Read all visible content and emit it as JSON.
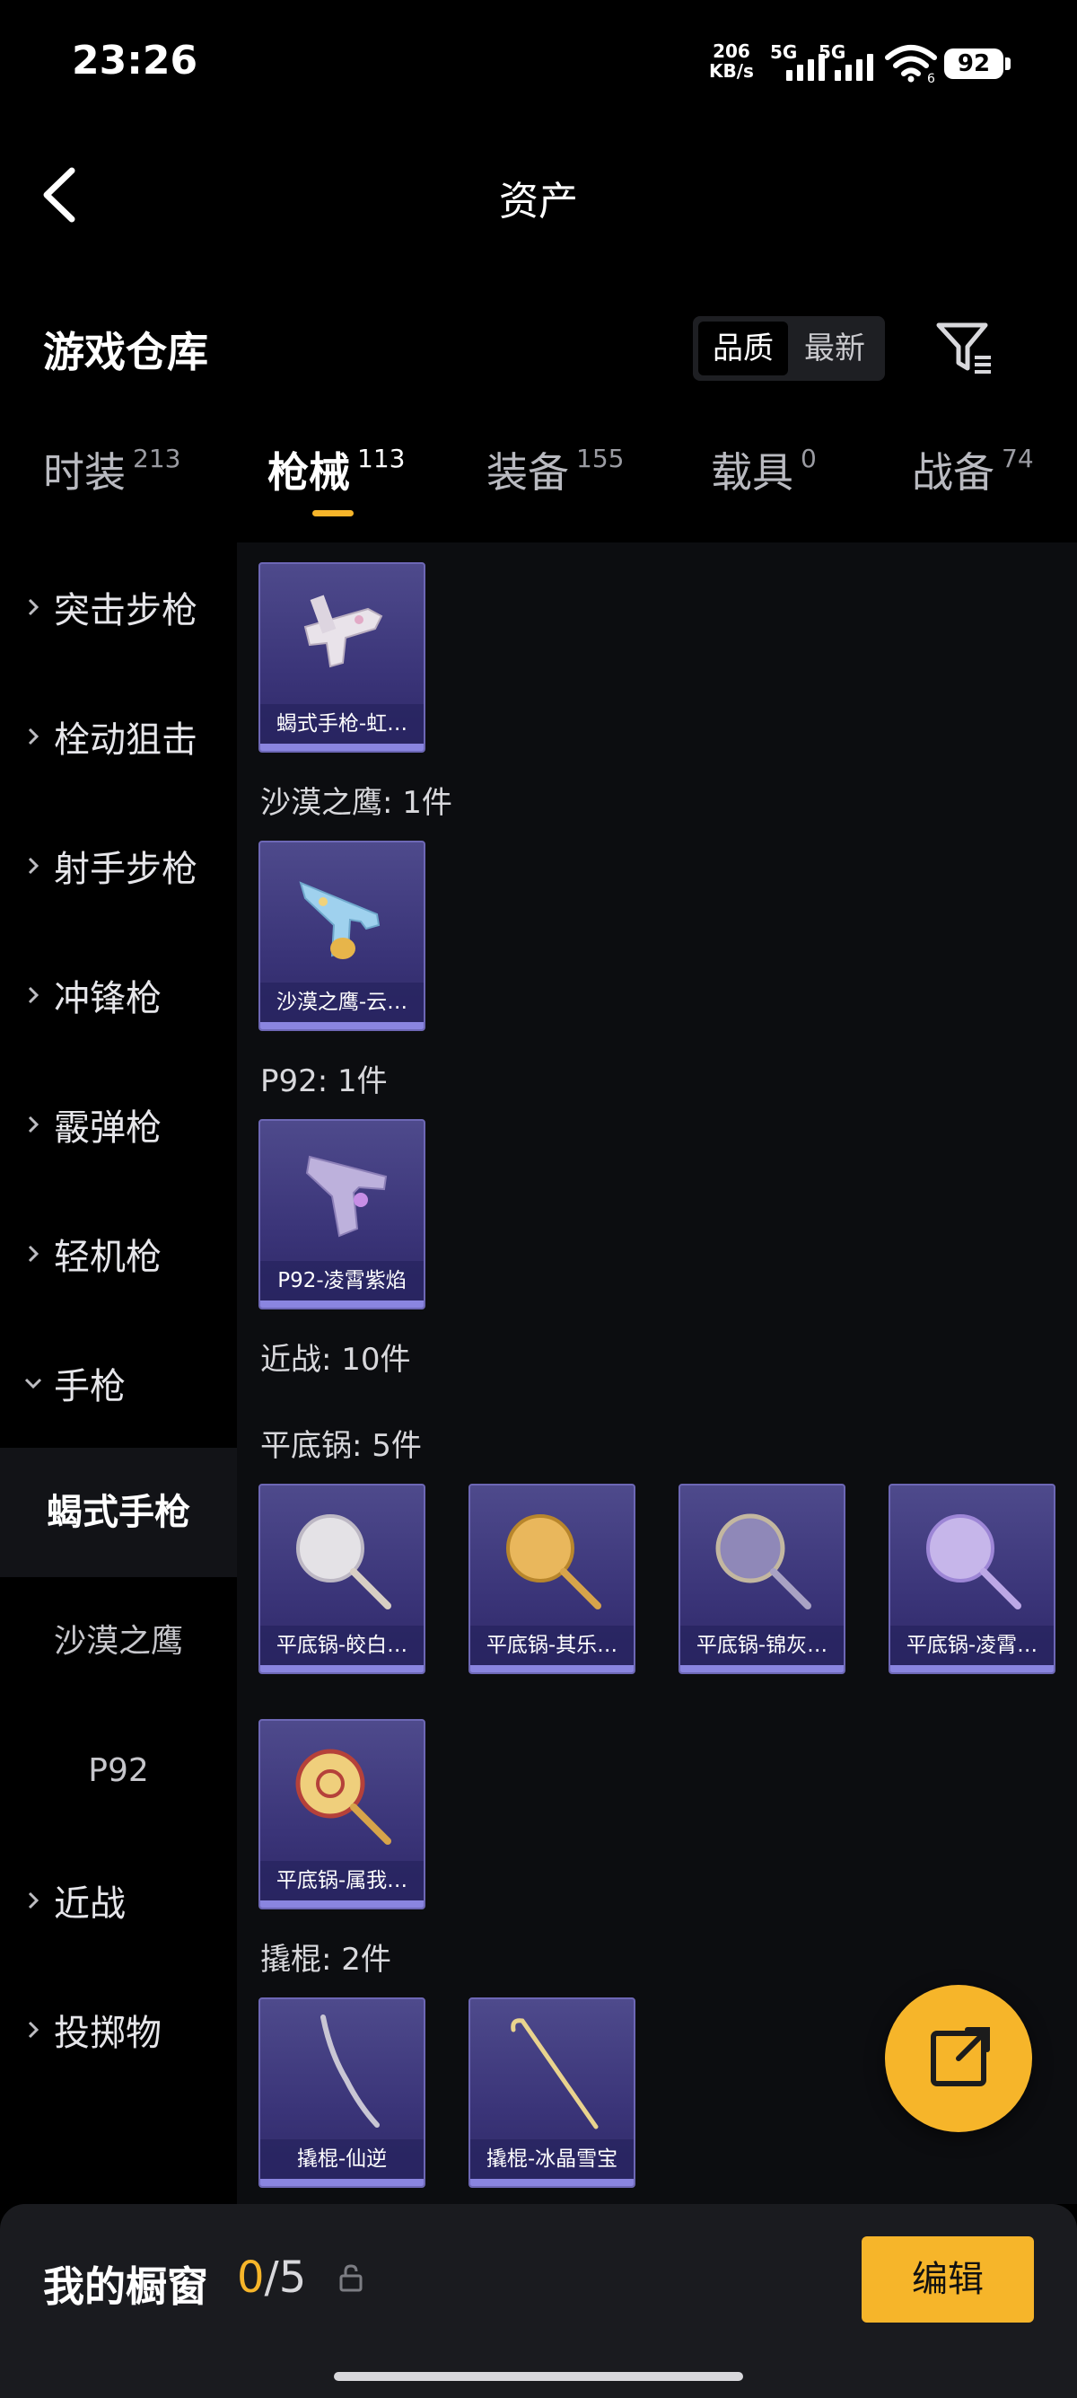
{
  "status_bar": {
    "time": "23:26",
    "net_speed_value": "206",
    "net_speed_unit": "KB/s",
    "signal_1_label": "5G",
    "signal_2_label": "5G",
    "wifi_label": "6",
    "battery": "92"
  },
  "header": {
    "title": "资产"
  },
  "warehouse": {
    "title": "游戏仓库",
    "sort_options": [
      "品质",
      "最新"
    ],
    "sort_selected": "品质"
  },
  "tabs": [
    {
      "label": "时装",
      "count": "213"
    },
    {
      "label": "枪械",
      "count": "113",
      "active": true
    },
    {
      "label": "装备",
      "count": "155"
    },
    {
      "label": "载具",
      "count": "0"
    },
    {
      "label": "战备",
      "count": "74"
    }
  ],
  "sidebar": {
    "categories": [
      {
        "label": "突击步枪"
      },
      {
        "label": "栓动狙击"
      },
      {
        "label": "射手步枪"
      },
      {
        "label": "冲锋枪"
      },
      {
        "label": "霰弹枪"
      },
      {
        "label": "轻机枪"
      },
      {
        "label": "手枪",
        "expanded": true
      }
    ],
    "subitems": [
      {
        "label": "蝎式手枪",
        "active": true
      },
      {
        "label": "沙漠之鹰"
      },
      {
        "label": "P92"
      }
    ],
    "categories_after": [
      {
        "label": "近战"
      },
      {
        "label": "投掷物"
      }
    ]
  },
  "content": {
    "groups": [
      {
        "label": "沙漠之鹰: 1件"
      },
      {
        "label": "P92: 1件"
      },
      {
        "label": "近战: 10件"
      },
      {
        "label": "平底锅: 5件"
      },
      {
        "label": "撬棍: 2件"
      }
    ],
    "items": [
      {
        "name": "蝎式手枪-虹…",
        "icon": "scorpion-pistol-icon"
      },
      {
        "name": "沙漠之鹰-云…",
        "icon": "desert-eagle-icon"
      },
      {
        "name": "P92-凌霄紫焰",
        "icon": "p92-pistol-icon"
      },
      {
        "name": "平底锅-皎白…",
        "icon": "frying-pan-icon"
      },
      {
        "name": "平底锅-其乐…",
        "icon": "frying-pan-icon"
      },
      {
        "name": "平底锅-锦灰…",
        "icon": "frying-pan-icon"
      },
      {
        "name": "平底锅-凌霄…",
        "icon": "frying-pan-icon"
      },
      {
        "name": "平底锅-属我…",
        "icon": "frying-pan-icon"
      },
      {
        "name": "撬棍-仙逆",
        "icon": "crowbar-icon"
      },
      {
        "name": "撬棍-冰晶雪宝",
        "icon": "crowbar-icon"
      }
    ]
  },
  "showcase": {
    "label": "我的橱窗",
    "current": "0",
    "total": "/5",
    "edit_label": "编辑"
  },
  "colors": {
    "accent": "#f6b52a",
    "card_bg": "#3a3478",
    "background": "#000000",
    "content_bg": "#0c0d10"
  }
}
